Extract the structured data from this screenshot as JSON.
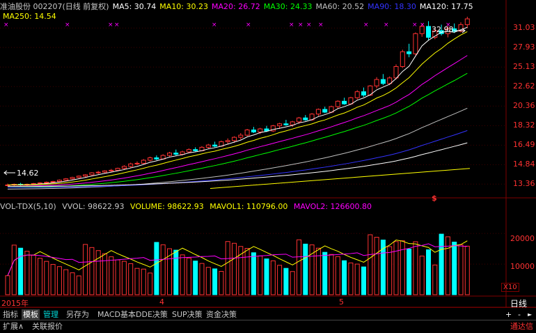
{
  "main_header": {
    "stock_title": "准油股份 002207(日线 前复权)",
    "ma": [
      {
        "label": "MA5: 30.74",
        "color": "#ffffff"
      },
      {
        "label": "MA10: 30.23",
        "color": "#ffff00"
      },
      {
        "label": "MA20: 26.72",
        "color": "#ff00ff"
      },
      {
        "label": "MA30: 24.33",
        "color": "#00ff00"
      },
      {
        "label": "MA60: 20.52",
        "color": "#c0c0c0"
      },
      {
        "label": "MA90: 18.30",
        "color": "#3333ff"
      },
      {
        "label": "MA120: 17.75",
        "color": "#ffffff"
      }
    ],
    "ma250": {
      "label": "MA250: 14.54",
      "color": "#ffff00"
    }
  },
  "price_axis": [
    "31.03",
    "27.93",
    "25.13",
    "22.62",
    "20.36",
    "18.32",
    "16.49",
    "14.84",
    "13.36"
  ],
  "annotations": {
    "high_price": "32.98",
    "low_price": "14.62",
    "dollar_marker": "$"
  },
  "vol_header": {
    "title": "VOL-TDX(5,10)",
    "vvol": "VVOL: 98622.93",
    "volume": "VOLUME: 98622.93",
    "mavol1": "MAVOL1: 110796.00",
    "mavol2": "MAVOL2: 126600.80"
  },
  "vol_axis": [
    "20000",
    "10000"
  ],
  "vol_unit": "X10",
  "date_axis": [
    "2015年",
    "4",
    "5"
  ],
  "period_label": "日线",
  "tabs": [
    "指标",
    "模板",
    "管理",
    "另存为",
    "MACD基本",
    "DDE决策",
    "SUP决策",
    "资金决策"
  ],
  "nav": {
    "plus": "+",
    "minus": "-",
    "left": "◄",
    "right": "►"
  },
  "bottom": {
    "expand": "扩展∧",
    "related": "关联报价",
    "tdx": "通达信"
  },
  "colors": {
    "up": "#ff3232",
    "down": "#00ffff",
    "bg": "#000000",
    "grid": "#800000"
  },
  "chart_data": {
    "type": "candlestick",
    "candles": [
      [
        13.3,
        13.4,
        13.2,
        13.3
      ],
      [
        13.3,
        13.4,
        13.2,
        13.35
      ],
      [
        13.35,
        13.45,
        13.25,
        13.3
      ],
      [
        13.3,
        13.4,
        13.2,
        13.35
      ],
      [
        13.35,
        13.45,
        13.3,
        13.4
      ],
      [
        13.4,
        13.5,
        13.35,
        13.45
      ],
      [
        13.45,
        13.55,
        13.4,
        13.5
      ],
      [
        13.5,
        13.6,
        13.45,
        13.55
      ],
      [
        13.55,
        13.7,
        13.5,
        13.65
      ],
      [
        13.65,
        13.8,
        13.6,
        13.75
      ],
      [
        13.75,
        13.9,
        13.7,
        13.85
      ],
      [
        13.85,
        14.0,
        13.8,
        13.95
      ],
      [
        13.95,
        14.1,
        13.85,
        14.05
      ],
      [
        14.05,
        14.25,
        14.0,
        14.2
      ],
      [
        14.2,
        14.35,
        14.1,
        14.25
      ],
      [
        14.25,
        14.4,
        14.15,
        14.35
      ],
      [
        14.35,
        14.5,
        14.25,
        14.4
      ],
      [
        14.4,
        14.6,
        14.35,
        14.55
      ],
      [
        14.55,
        14.8,
        14.45,
        14.7
      ],
      [
        14.7,
        15.0,
        14.6,
        14.9
      ],
      [
        14.9,
        15.1,
        14.8,
        14.95
      ],
      [
        14.95,
        15.3,
        14.85,
        15.2
      ],
      [
        15.2,
        15.5,
        15.1,
        15.4
      ],
      [
        15.4,
        15.6,
        15.2,
        15.3
      ],
      [
        15.3,
        15.7,
        15.25,
        15.6
      ],
      [
        15.6,
        15.9,
        15.5,
        15.8
      ],
      [
        15.8,
        16.1,
        15.6,
        15.7
      ],
      [
        15.7,
        16.0,
        15.6,
        15.9
      ],
      [
        15.9,
        16.2,
        15.8,
        16.1
      ],
      [
        16.1,
        16.3,
        15.9,
        16.0
      ],
      [
        16.0,
        16.4,
        15.95,
        16.3
      ],
      [
        16.3,
        16.6,
        16.2,
        16.5
      ],
      [
        16.5,
        16.8,
        16.3,
        16.4
      ],
      [
        16.4,
        16.9,
        16.35,
        16.8
      ],
      [
        16.8,
        17.1,
        16.6,
        16.9
      ],
      [
        16.9,
        17.3,
        16.7,
        17.2
      ],
      [
        17.2,
        17.6,
        17.0,
        17.4
      ],
      [
        17.4,
        18.0,
        17.3,
        17.9
      ],
      [
        17.9,
        18.2,
        17.6,
        17.7
      ],
      [
        17.7,
        18.1,
        17.5,
        18.0
      ],
      [
        18.0,
        18.3,
        17.7,
        17.8
      ],
      [
        17.8,
        18.4,
        17.7,
        18.3
      ],
      [
        18.3,
        18.6,
        18.0,
        18.5
      ],
      [
        18.5,
        18.9,
        18.3,
        18.4
      ],
      [
        18.4,
        18.8,
        18.2,
        18.7
      ],
      [
        18.7,
        19.2,
        18.5,
        19.1
      ],
      [
        19.1,
        19.4,
        18.8,
        18.9
      ],
      [
        18.9,
        19.6,
        18.8,
        19.5
      ],
      [
        19.5,
        20.1,
        19.3,
        20.0
      ],
      [
        20.0,
        20.3,
        19.6,
        19.7
      ],
      [
        19.7,
        20.4,
        19.6,
        20.3
      ],
      [
        20.3,
        21.0,
        20.1,
        20.9
      ],
      [
        20.9,
        21.3,
        20.5,
        20.6
      ],
      [
        20.6,
        21.4,
        20.5,
        21.3
      ],
      [
        21.3,
        22.2,
        21.1,
        22.0
      ],
      [
        22.0,
        22.5,
        21.4,
        21.6
      ],
      [
        21.6,
        22.8,
        21.5,
        22.7
      ],
      [
        22.7,
        23.8,
        22.4,
        23.5
      ],
      [
        23.5,
        24.2,
        22.8,
        23.0
      ],
      [
        23.0,
        23.9,
        22.8,
        23.7
      ],
      [
        23.7,
        25.5,
        23.5,
        25.2
      ],
      [
        25.2,
        27.6,
        25.0,
        27.3
      ],
      [
        27.3,
        28.5,
        26.5,
        27.0
      ],
      [
        27.0,
        30.3,
        26.8,
        30.1
      ],
      [
        30.1,
        31.8,
        29.6,
        31.3
      ],
      [
        31.3,
        32.2,
        29.0,
        29.5
      ],
      [
        29.5,
        31.0,
        29.2,
        30.6
      ],
      [
        30.6,
        31.6,
        29.8,
        30.1
      ],
      [
        30.1,
        31.4,
        29.5,
        30.9
      ],
      [
        30.9,
        31.8,
        30.2,
        30.5
      ],
      [
        30.5,
        32.0,
        30.3,
        31.6
      ],
      [
        31.6,
        32.98,
        31.0,
        32.6
      ]
    ],
    "volume_ref": [
      10000,
      20000
    ]
  }
}
